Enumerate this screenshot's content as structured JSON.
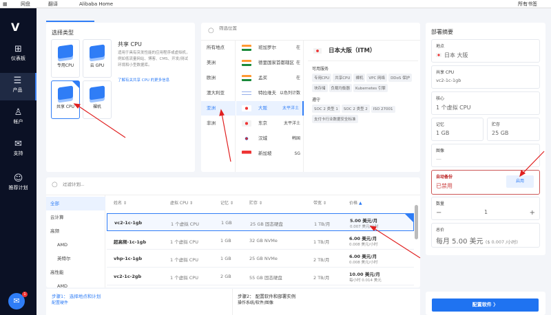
{
  "browser": {
    "bookmarks": [
      "网盘",
      "翻译",
      "Alibaba Home"
    ],
    "all_bookmarks": "所有书签"
  },
  "sidebar": {
    "items": [
      {
        "label": "仪表板",
        "icon": "dashboard-icon"
      },
      {
        "label": "产品",
        "icon": "products-icon",
        "active": true
      },
      {
        "label": "帐户",
        "icon": "account-icon"
      },
      {
        "label": "支持",
        "icon": "support-icon"
      },
      {
        "label": "推荐计划",
        "icon": "referral-icon"
      }
    ]
  },
  "type_panel": {
    "title": "选择类型",
    "types": [
      {
        "label": "专用CPU"
      },
      {
        "label": "云 GPU"
      },
      {
        "label": "共享 CPU",
        "selected": true
      },
      {
        "label": "裸机"
      }
    ],
    "desc_title": "共享 CPU",
    "desc": "适用于具有突发性能的应用程序或虚拟机，例如低流量网站、博客、CMS、开发/测试环境和小型数据库。",
    "link": "了解有关共享 CPU 的更多信息"
  },
  "location_panel": {
    "search_placeholder": "筛选位置",
    "regions": [
      "所有地点",
      "美洲",
      "欧洲",
      "澳大利亚",
      "亚洲",
      "非洲"
    ],
    "selected_region": "亚洲",
    "cities": [
      {
        "name": "班加罗尔",
        "region": "在",
        "flag": "india"
      },
      {
        "name": "德里国家首都辖区",
        "region": "在",
        "flag": "india"
      },
      {
        "name": "孟买",
        "region": "在",
        "flag": "india"
      },
      {
        "name": "特拉维夫",
        "region": "以色列计数",
        "flag": "israel"
      },
      {
        "name": "大阪",
        "region": "太平洋土",
        "flag": "japan",
        "selected": true
      },
      {
        "name": "东京",
        "region": "太平洋土",
        "flag": "japan"
      },
      {
        "name": "汉城",
        "region": "韩国",
        "flag": "korea"
      },
      {
        "name": "新加坡",
        "region": "SG",
        "flag": "singapore"
      }
    ],
    "detail": {
      "title": "日本大阪（ITM）",
      "services_label": "可用服务",
      "services": [
        "专用CPU",
        "共享CPU",
        "裸机",
        "VPC 网络",
        "DDoS 保护",
        "块存储",
        "负载均衡器",
        "Kubernetes 引擎"
      ],
      "compliance_label": "遵守",
      "compliance": [
        "SOC 2 类型 1",
        "SOC 2 类型 2",
        "ISO 27001",
        "支付卡行业数据安全标准"
      ]
    }
  },
  "summary": {
    "title": "部署摘要",
    "location_label": "地点",
    "location": "日本 大阪",
    "plan_label": "共享 CPU",
    "plan": "vc2-1c-1gb",
    "cores_label": "核心",
    "cores": "1 个虚拟 CPU",
    "memory_label": "记忆",
    "memory": "1 GB",
    "storage_label": "贮存",
    "storage": "25 GB",
    "image_label": "图像",
    "image": "—",
    "backup_label": "自动备份",
    "backup_status": "已禁用",
    "backup_button": "启用",
    "qty_label": "数量",
    "qty": "1",
    "qty_minus": "−",
    "qty_plus": "+",
    "total_label": "总价",
    "total": "每月 5.00 美元",
    "total_hourly": "($ 0.007 /小时)"
  },
  "plans": {
    "search_placeholder": "过滤计划...",
    "tabs": [
      "全部",
      "云计算",
      "高频",
      "AMD",
      "英特尔",
      "高性能",
      "AMD"
    ],
    "columns": [
      "姓名",
      "虚拟 CPU",
      "记忆",
      "贮存",
      "带宽",
      "价格"
    ],
    "rows": [
      {
        "name": "vc2-1c-1gb",
        "cpu": "1 个虚拟 CPU",
        "mem": "1 GB",
        "storage": "25 GB 固态硬盘",
        "bw": "1 TB/月",
        "price": "5.00 美元/月",
        "hourly": "0.007 美元/小时",
        "selected": true
      },
      {
        "name": "超高频-1c-1gb",
        "cpu": "1 个虚拟 CPU",
        "mem": "1 GB",
        "storage": "32 GB NVMe",
        "bw": "1 TB/月",
        "price": "6.00 美元/月",
        "hourly": "0.008 美元/小时"
      },
      {
        "name": "vhp-1c-1gb",
        "cpu": "1 个虚拟 CPU",
        "mem": "1 GB",
        "storage": "25 GB NVMe",
        "bw": "2 TB/月",
        "price": "6.00 美元/月",
        "hourly": "0.008 美元/小时"
      },
      {
        "name": "vc2-1c-2gb",
        "cpu": "1 个虚拟 CPU",
        "mem": "2 GB",
        "storage": "55 GB 固态硬盘",
        "bw": "2 TB/月",
        "price": "10.00 美元/月",
        "hourly": "每小时 0.014 美元"
      }
    ]
  },
  "steps": {
    "step1": "步骤1： 选择地点和计划",
    "step1_sub": "配置硬件",
    "step2": "步骤2： 配置软件和部署实例",
    "step2_sub": "操作系统/软件/图像"
  },
  "deploy_button": "配置软件  〉",
  "chat_badge": "1"
}
